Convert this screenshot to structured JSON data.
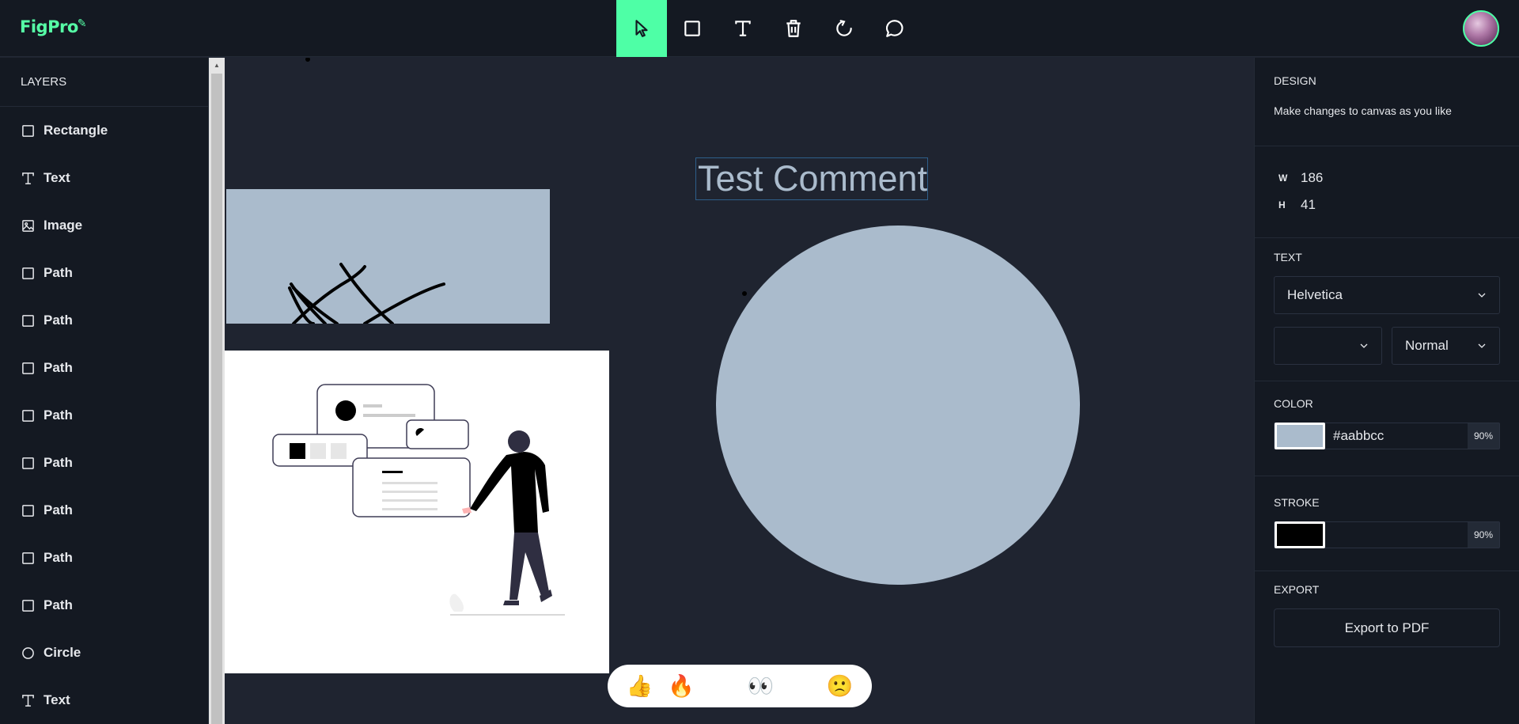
{
  "app": {
    "logo_text": "FigPro",
    "accent": "#4effa6"
  },
  "toolbar": {
    "tools": [
      {
        "name": "select",
        "icon": "cursor-icon",
        "active": true
      },
      {
        "name": "rectangle",
        "icon": "square-icon"
      },
      {
        "name": "text",
        "icon": "text-icon"
      },
      {
        "name": "delete",
        "icon": "trash-icon"
      },
      {
        "name": "reset",
        "icon": "reload-icon"
      },
      {
        "name": "comment",
        "icon": "comment-icon"
      }
    ]
  },
  "layers": {
    "title": "LAYERS",
    "items": [
      {
        "label": "Rectangle",
        "icon": "square-icon"
      },
      {
        "label": "Text",
        "icon": "text-icon"
      },
      {
        "label": "Image",
        "icon": "image-icon"
      },
      {
        "label": "Path",
        "icon": "square-icon"
      },
      {
        "label": "Path",
        "icon": "square-icon"
      },
      {
        "label": "Path",
        "icon": "square-icon"
      },
      {
        "label": "Path",
        "icon": "square-icon"
      },
      {
        "label": "Path",
        "icon": "square-icon"
      },
      {
        "label": "Path",
        "icon": "square-icon"
      },
      {
        "label": "Path",
        "icon": "square-icon"
      },
      {
        "label": "Path",
        "icon": "square-icon"
      },
      {
        "label": "Circle",
        "icon": "circle-icon"
      },
      {
        "label": "Text",
        "icon": "text-icon"
      }
    ]
  },
  "canvas": {
    "comment_text": "Test Comment",
    "shape_fill": "#aabbcc",
    "reactions": [
      "👍",
      "🔥",
      "😍",
      "👀",
      "😱",
      "🙁"
    ]
  },
  "design": {
    "title": "DESIGN",
    "subtitle": "Make changes to canvas as you like",
    "width_label": "W",
    "width_value": "186",
    "height_label": "H",
    "height_value": "41",
    "text_title": "TEXT",
    "font_family": "Helvetica",
    "font_size": "",
    "font_weight": "Normal",
    "color_title": "COLOR",
    "color_value": "#aabbcc",
    "color_opacity": "90%",
    "stroke_title": "STROKE",
    "stroke_color": "#000000",
    "stroke_opacity": "90%",
    "export_title": "EXPORT",
    "export_label": "Export to PDF"
  }
}
